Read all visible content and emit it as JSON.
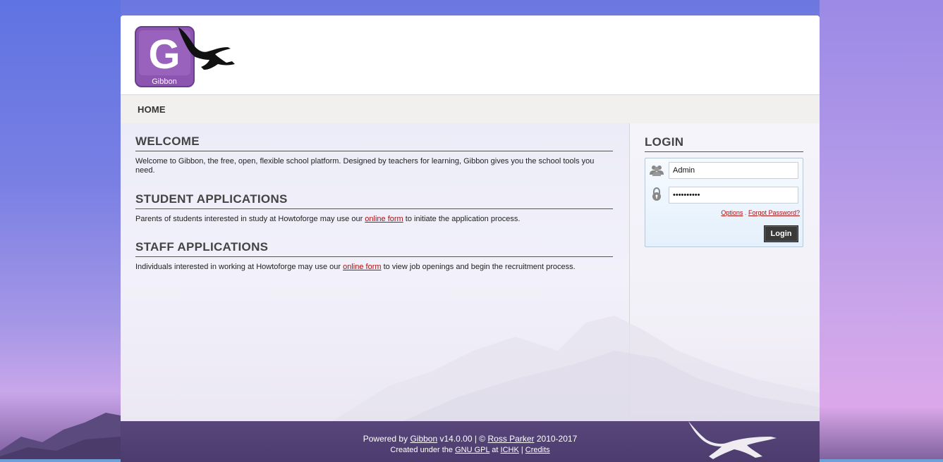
{
  "app": {
    "logo_text": "Gibbon"
  },
  "nav": {
    "home_label": "HOME"
  },
  "welcome": {
    "title": "WELCOME",
    "text": "Welcome to Gibbon, the free, open, flexible school platform. Designed by teachers for learning, Gibbon gives you the school tools you need."
  },
  "student_apps": {
    "title": "STUDENT APPLICATIONS",
    "text_before": "Parents of students interested in study at Howtoforge may use our ",
    "link": "online form",
    "text_after": " to initiate the application process."
  },
  "staff_apps": {
    "title": "STAFF APPLICATIONS",
    "text_before": "Individuals interested in working at Howtoforge may use our ",
    "link": "online form",
    "text_after": " to view job openings and begin the recruitment process."
  },
  "login": {
    "title": "LOGIN",
    "username_value": "Admin",
    "password_value": "••••••••••",
    "options_label": "Options",
    "separator": ".",
    "forgot_label": "Forgot Password?",
    "button_label": "Login"
  },
  "footer": {
    "powered_by": "Powered by ",
    "gibbon_link": "Gibbon",
    "version_text": " v14.0.00 | © ",
    "author_link": "Ross Parker",
    "years": " 2010-2017",
    "created_under": "Created under the ",
    "license_link": "GNU GPL",
    "at_text": " at ",
    "org_link": "ICHK",
    "pipe": " | ",
    "credits_link": "Credits"
  },
  "colors": {
    "logo_purple": "#8b55b0",
    "link_red": "#a81010",
    "footer_bg": "#4f3f72",
    "button_dark": "#3a3a3a"
  }
}
